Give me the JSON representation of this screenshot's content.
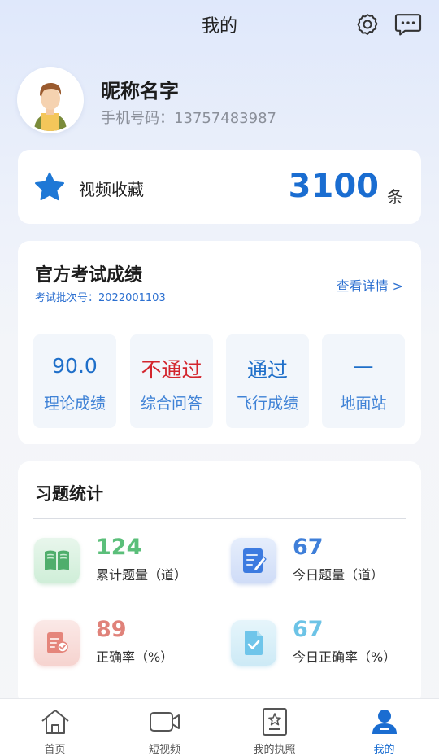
{
  "header": {
    "title": "我的"
  },
  "profile": {
    "nickname": "昵称名字",
    "phone_label": "手机号码：",
    "phone": "13757483987"
  },
  "favorites": {
    "label": "视频收藏",
    "count": "3100",
    "unit": "条"
  },
  "exam": {
    "title": "官方考试成绩",
    "batch_label": "考试批次号：",
    "batch_no": "2022001103",
    "detail_link": "查看详情 >",
    "scores": [
      {
        "value": "90.0",
        "label": "理论成绩",
        "status": "normal"
      },
      {
        "value": "不通过",
        "label": "综合问答",
        "status": "fail"
      },
      {
        "value": "通过",
        "label": "飞行成绩",
        "status": "normal"
      },
      {
        "value": "—",
        "label": "地面站",
        "status": "normal"
      }
    ]
  },
  "stats": {
    "title": "习题统计",
    "items": [
      {
        "value": "124",
        "label": "累计题量（道）",
        "color": "#5bbf7a",
        "icon": "book-icon"
      },
      {
        "value": "67",
        "label": "今日题量（道）",
        "color": "#3f7fd9",
        "icon": "edit-note-icon"
      },
      {
        "value": "89",
        "label": "正确率（%）",
        "color": "#e0827a",
        "icon": "check-form-icon"
      },
      {
        "value": "67",
        "label": "今日正确率（%）",
        "color": "#6cc3e6",
        "icon": "check-doc-icon"
      }
    ]
  },
  "tabs": [
    {
      "label": "首页",
      "icon": "home-icon"
    },
    {
      "label": "短视频",
      "icon": "video-icon"
    },
    {
      "label": "我的执照",
      "icon": "license-icon"
    },
    {
      "label": "我的",
      "icon": "user-icon",
      "active": true
    }
  ],
  "colors": {
    "accent": "#1a6dd1",
    "fail": "#d3252d"
  }
}
